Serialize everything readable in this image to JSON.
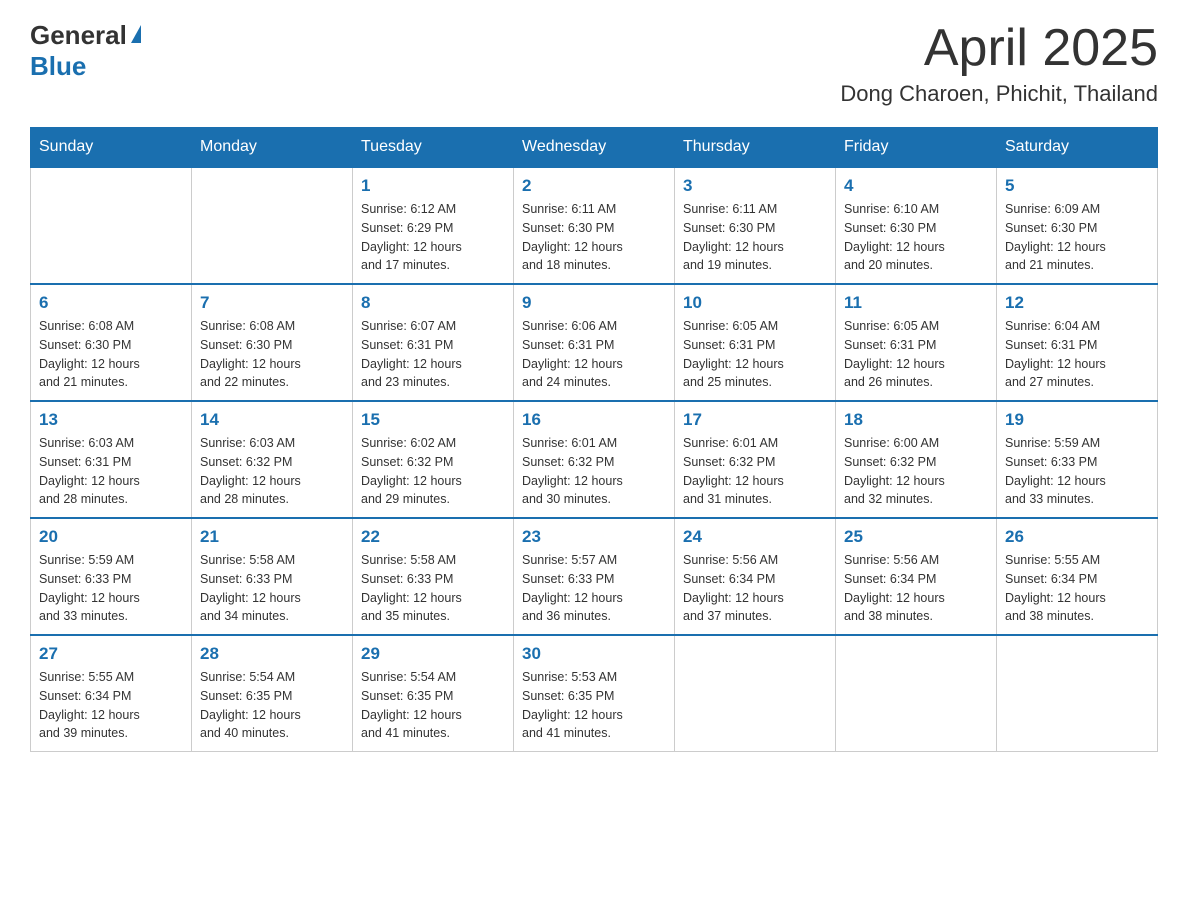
{
  "header": {
    "logo_general": "General",
    "logo_blue": "Blue",
    "month_year": "April 2025",
    "location": "Dong Charoen, Phichit, Thailand"
  },
  "weekdays": [
    "Sunday",
    "Monday",
    "Tuesday",
    "Wednesday",
    "Thursday",
    "Friday",
    "Saturday"
  ],
  "weeks": [
    [
      {
        "day": "",
        "info": ""
      },
      {
        "day": "",
        "info": ""
      },
      {
        "day": "1",
        "info": "Sunrise: 6:12 AM\nSunset: 6:29 PM\nDaylight: 12 hours\nand 17 minutes."
      },
      {
        "day": "2",
        "info": "Sunrise: 6:11 AM\nSunset: 6:30 PM\nDaylight: 12 hours\nand 18 minutes."
      },
      {
        "day": "3",
        "info": "Sunrise: 6:11 AM\nSunset: 6:30 PM\nDaylight: 12 hours\nand 19 minutes."
      },
      {
        "day": "4",
        "info": "Sunrise: 6:10 AM\nSunset: 6:30 PM\nDaylight: 12 hours\nand 20 minutes."
      },
      {
        "day": "5",
        "info": "Sunrise: 6:09 AM\nSunset: 6:30 PM\nDaylight: 12 hours\nand 21 minutes."
      }
    ],
    [
      {
        "day": "6",
        "info": "Sunrise: 6:08 AM\nSunset: 6:30 PM\nDaylight: 12 hours\nand 21 minutes."
      },
      {
        "day": "7",
        "info": "Sunrise: 6:08 AM\nSunset: 6:30 PM\nDaylight: 12 hours\nand 22 minutes."
      },
      {
        "day": "8",
        "info": "Sunrise: 6:07 AM\nSunset: 6:31 PM\nDaylight: 12 hours\nand 23 minutes."
      },
      {
        "day": "9",
        "info": "Sunrise: 6:06 AM\nSunset: 6:31 PM\nDaylight: 12 hours\nand 24 minutes."
      },
      {
        "day": "10",
        "info": "Sunrise: 6:05 AM\nSunset: 6:31 PM\nDaylight: 12 hours\nand 25 minutes."
      },
      {
        "day": "11",
        "info": "Sunrise: 6:05 AM\nSunset: 6:31 PM\nDaylight: 12 hours\nand 26 minutes."
      },
      {
        "day": "12",
        "info": "Sunrise: 6:04 AM\nSunset: 6:31 PM\nDaylight: 12 hours\nand 27 minutes."
      }
    ],
    [
      {
        "day": "13",
        "info": "Sunrise: 6:03 AM\nSunset: 6:31 PM\nDaylight: 12 hours\nand 28 minutes."
      },
      {
        "day": "14",
        "info": "Sunrise: 6:03 AM\nSunset: 6:32 PM\nDaylight: 12 hours\nand 28 minutes."
      },
      {
        "day": "15",
        "info": "Sunrise: 6:02 AM\nSunset: 6:32 PM\nDaylight: 12 hours\nand 29 minutes."
      },
      {
        "day": "16",
        "info": "Sunrise: 6:01 AM\nSunset: 6:32 PM\nDaylight: 12 hours\nand 30 minutes."
      },
      {
        "day": "17",
        "info": "Sunrise: 6:01 AM\nSunset: 6:32 PM\nDaylight: 12 hours\nand 31 minutes."
      },
      {
        "day": "18",
        "info": "Sunrise: 6:00 AM\nSunset: 6:32 PM\nDaylight: 12 hours\nand 32 minutes."
      },
      {
        "day": "19",
        "info": "Sunrise: 5:59 AM\nSunset: 6:33 PM\nDaylight: 12 hours\nand 33 minutes."
      }
    ],
    [
      {
        "day": "20",
        "info": "Sunrise: 5:59 AM\nSunset: 6:33 PM\nDaylight: 12 hours\nand 33 minutes."
      },
      {
        "day": "21",
        "info": "Sunrise: 5:58 AM\nSunset: 6:33 PM\nDaylight: 12 hours\nand 34 minutes."
      },
      {
        "day": "22",
        "info": "Sunrise: 5:58 AM\nSunset: 6:33 PM\nDaylight: 12 hours\nand 35 minutes."
      },
      {
        "day": "23",
        "info": "Sunrise: 5:57 AM\nSunset: 6:33 PM\nDaylight: 12 hours\nand 36 minutes."
      },
      {
        "day": "24",
        "info": "Sunrise: 5:56 AM\nSunset: 6:34 PM\nDaylight: 12 hours\nand 37 minutes."
      },
      {
        "day": "25",
        "info": "Sunrise: 5:56 AM\nSunset: 6:34 PM\nDaylight: 12 hours\nand 38 minutes."
      },
      {
        "day": "26",
        "info": "Sunrise: 5:55 AM\nSunset: 6:34 PM\nDaylight: 12 hours\nand 38 minutes."
      }
    ],
    [
      {
        "day": "27",
        "info": "Sunrise: 5:55 AM\nSunset: 6:34 PM\nDaylight: 12 hours\nand 39 minutes."
      },
      {
        "day": "28",
        "info": "Sunrise: 5:54 AM\nSunset: 6:35 PM\nDaylight: 12 hours\nand 40 minutes."
      },
      {
        "day": "29",
        "info": "Sunrise: 5:54 AM\nSunset: 6:35 PM\nDaylight: 12 hours\nand 41 minutes."
      },
      {
        "day": "30",
        "info": "Sunrise: 5:53 AM\nSunset: 6:35 PM\nDaylight: 12 hours\nand 41 minutes."
      },
      {
        "day": "",
        "info": ""
      },
      {
        "day": "",
        "info": ""
      },
      {
        "day": "",
        "info": ""
      }
    ]
  ]
}
